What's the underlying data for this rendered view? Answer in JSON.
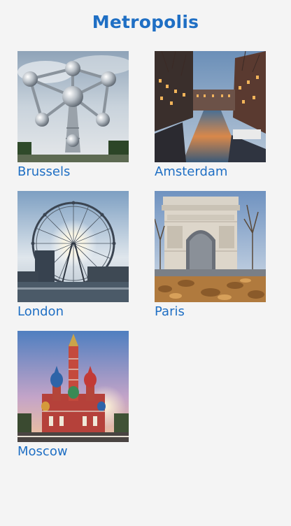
{
  "app": {
    "title": "Metropolis"
  },
  "cities": [
    {
      "name": "Brussels",
      "image_icon": "atomium-photo"
    },
    {
      "name": "Amsterdam",
      "image_icon": "canal-photo"
    },
    {
      "name": "London",
      "image_icon": "london-eye-photo"
    },
    {
      "name": "Paris",
      "image_icon": "arc-de-triomphe-photo"
    },
    {
      "name": "Moscow",
      "image_icon": "st-basils-cathedral-photo"
    }
  ],
  "colors": {
    "accent": "#1f6fc4",
    "background": "#f4f4f4"
  }
}
